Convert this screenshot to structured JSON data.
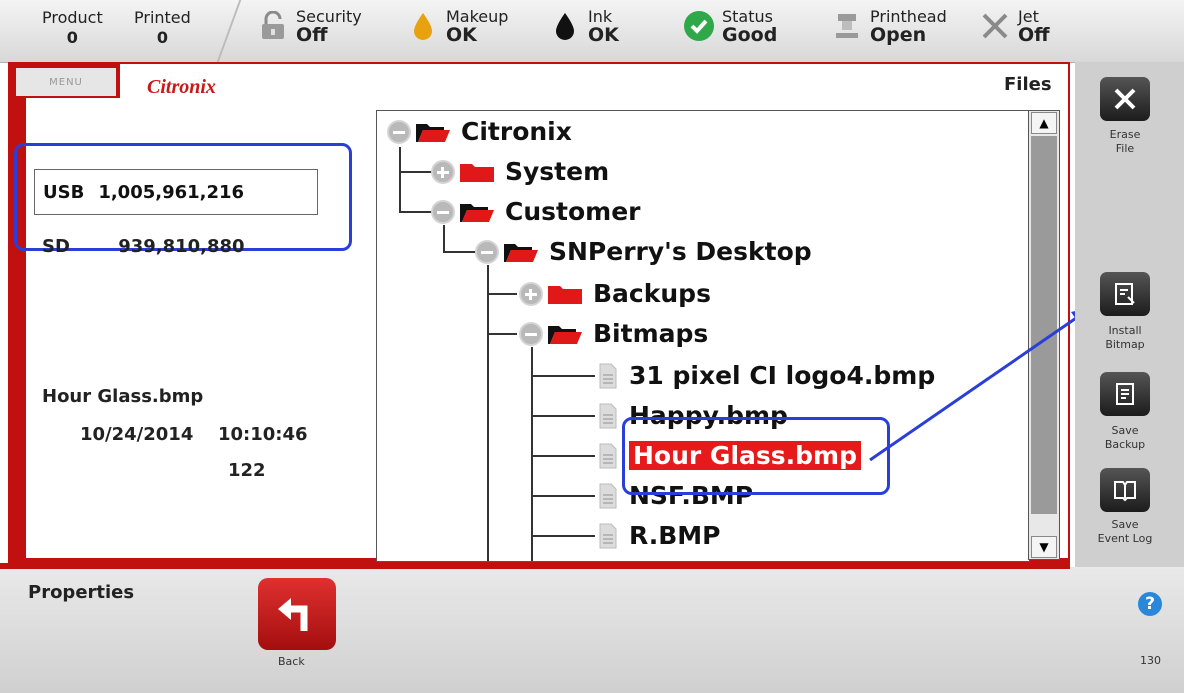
{
  "status": {
    "product": {
      "label": "Product",
      "value": "0"
    },
    "printed": {
      "label": "Printed",
      "value": "0"
    },
    "security": {
      "label": "Security",
      "value": "Off"
    },
    "makeup": {
      "label": "Makeup",
      "value": "OK"
    },
    "ink": {
      "label": "Ink",
      "value": "OK"
    },
    "state": {
      "label": "Status",
      "value": "Good"
    },
    "printhead": {
      "label": "Printhead",
      "value": "Open"
    },
    "jet": {
      "label": "Jet",
      "value": "Off"
    }
  },
  "header": {
    "menu_label": "MENU",
    "brand": "Citronix",
    "section_title": "Files"
  },
  "storage": {
    "usb": {
      "label": "USB",
      "value": "1,005,961,216"
    },
    "sd": {
      "label": "SD",
      "value": "939,810,880"
    }
  },
  "selected_file": {
    "name": "Hour Glass.bmp",
    "date": "10/24/2014",
    "time": "10:10:46",
    "size": "122"
  },
  "tree": {
    "root": "Citronix",
    "system": "System",
    "customer": "Customer",
    "desktop": "SNPerry's Desktop",
    "backups": "Backups",
    "bitmaps": "Bitmaps",
    "files": [
      "31 pixel CI logo4.bmp",
      "Happy.bmp",
      "Hour Glass.bmp",
      "NSF.BMP",
      "R.BMP"
    ]
  },
  "toolbar": {
    "erase": [
      "Erase",
      "File"
    ],
    "install": [
      "Install",
      "Bitmap"
    ],
    "save_backup": [
      "Save",
      "Backup"
    ],
    "save_event": [
      "Save",
      "Event Log"
    ]
  },
  "bottom": {
    "properties_label": "Properties",
    "back_label": "Back",
    "page_number": "130"
  },
  "colors": {
    "accent_red": "#c01010",
    "highlight_red": "#e61a1a",
    "annotation_blue": "#2a3fd8",
    "status_green": "#2fa84a",
    "makeup_amber": "#e8a210"
  }
}
